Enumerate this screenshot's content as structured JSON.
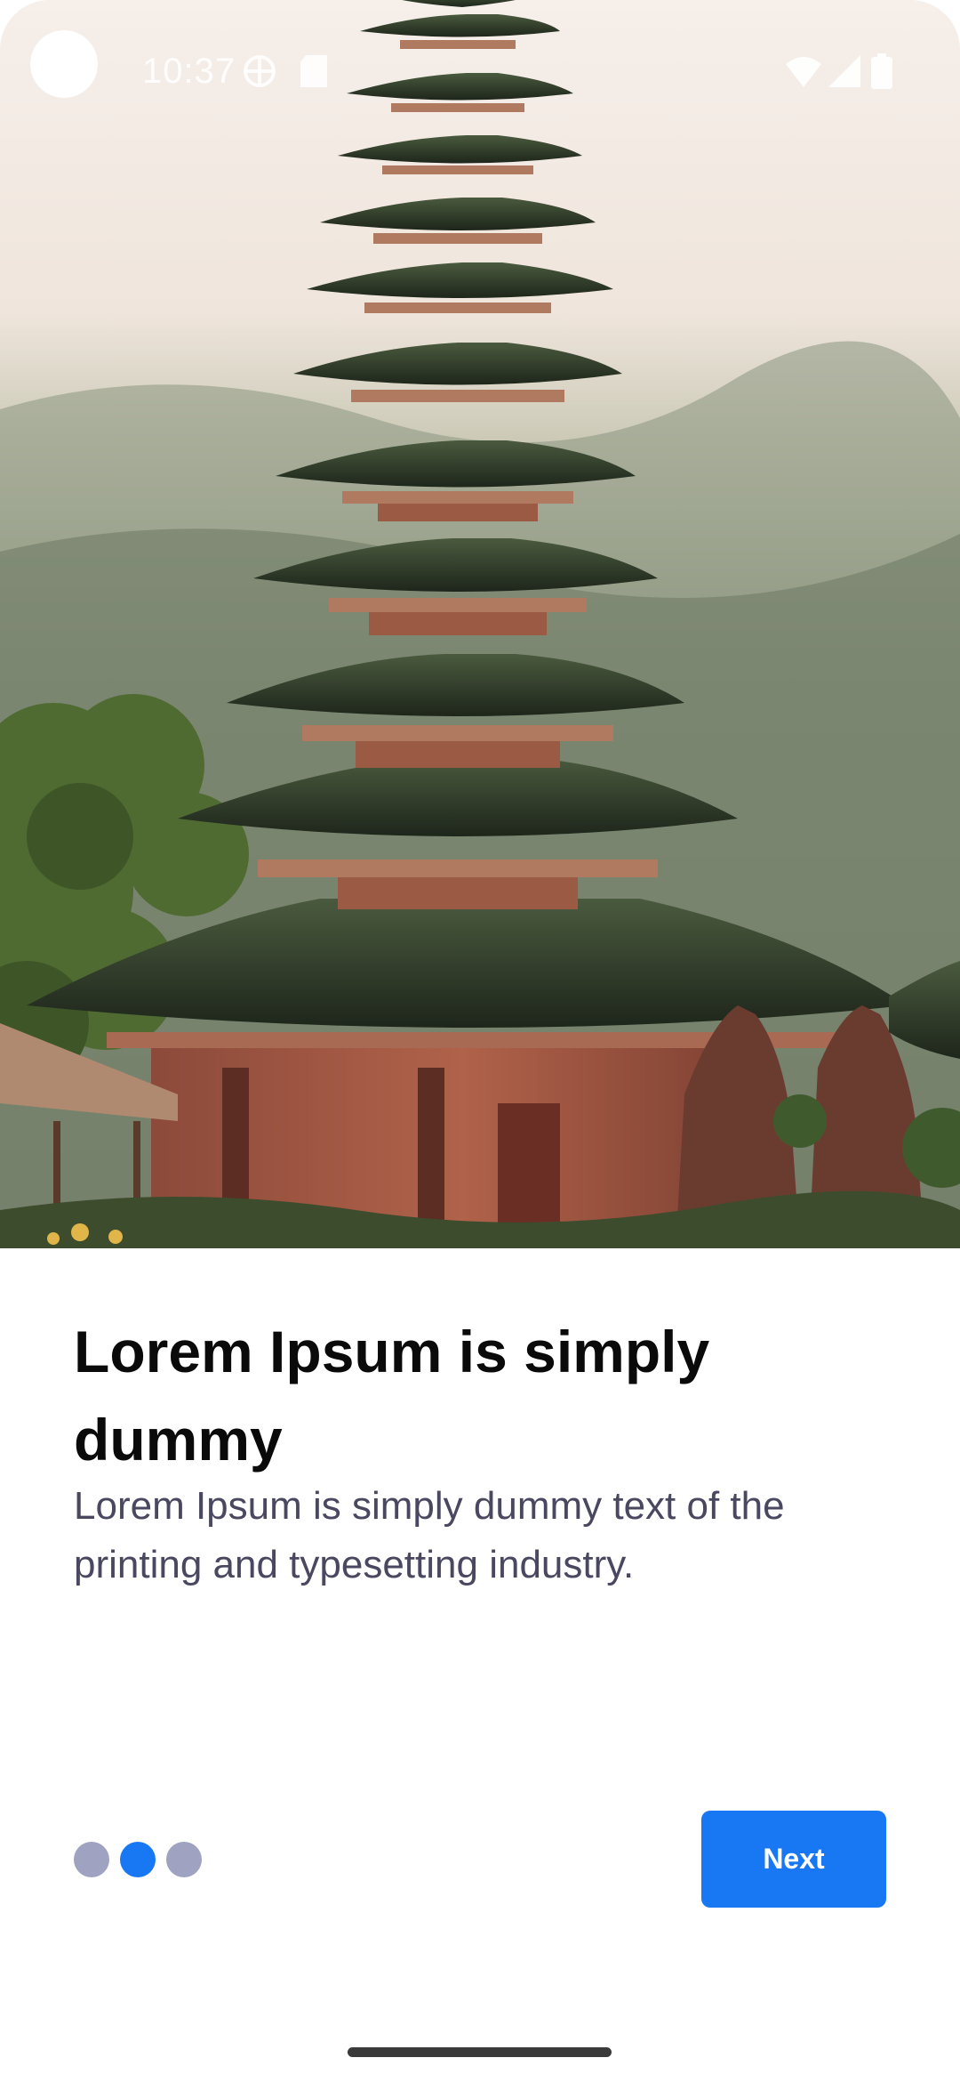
{
  "status_bar": {
    "time": "10:37"
  },
  "hero": {
    "image": "temple-pagoda-photo"
  },
  "content": {
    "title": "Lorem Ipsum is simply dummy",
    "subtitle": "Lorem Ipsum is simply dummy text of the printing and typesetting industry."
  },
  "pager": {
    "total": 3,
    "active_index": 1
  },
  "actions": {
    "next_label": "Next"
  },
  "colors": {
    "accent": "#1877f2",
    "dot_inactive": "#9fa2c0",
    "title": "#0a0a0a",
    "subtitle": "#4a4860"
  },
  "icons": [
    "vpn-icon",
    "sd-card-icon",
    "wifi-icon",
    "signal-icon",
    "battery-icon"
  ]
}
